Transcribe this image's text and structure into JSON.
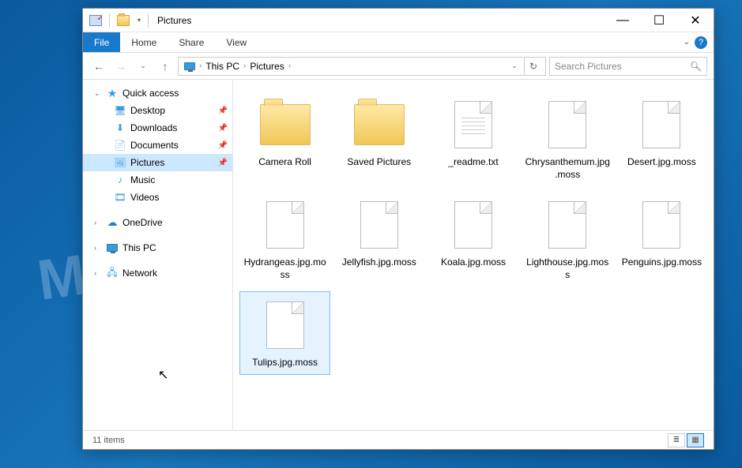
{
  "window": {
    "title": "Pictures",
    "controls": {
      "minimize": "—",
      "maximize": "☐",
      "close": "✕"
    }
  },
  "ribbon": {
    "file": "File",
    "tabs": [
      "Home",
      "Share",
      "View"
    ]
  },
  "nav": {
    "back": "←",
    "forward": "→",
    "up": "↑",
    "crumbs": [
      "This PC",
      "Pictures"
    ],
    "refresh": "↻",
    "search_placeholder": "Search Pictures"
  },
  "sidebar": {
    "quick_access": {
      "label": "Quick access",
      "expanded": true
    },
    "qa_items": [
      {
        "label": "Desktop",
        "icon": "desktop",
        "pinned": true
      },
      {
        "label": "Downloads",
        "icon": "downloads",
        "pinned": true
      },
      {
        "label": "Documents",
        "icon": "documents",
        "pinned": true
      },
      {
        "label": "Pictures",
        "icon": "pictures",
        "pinned": true,
        "selected": true
      },
      {
        "label": "Music",
        "icon": "music",
        "pinned": false
      },
      {
        "label": "Videos",
        "icon": "videos",
        "pinned": false
      }
    ],
    "onedrive": "OneDrive",
    "this_pc": "This PC",
    "network": "Network"
  },
  "items": [
    {
      "name": "Camera Roll",
      "kind": "folder"
    },
    {
      "name": "Saved Pictures",
      "kind": "folder"
    },
    {
      "name": "_readme.txt",
      "kind": "text"
    },
    {
      "name": "Chrysanthemum.jpg.moss",
      "kind": "file"
    },
    {
      "name": "Desert.jpg.moss",
      "kind": "file"
    },
    {
      "name": "Hydrangeas.jpg.moss",
      "kind": "file"
    },
    {
      "name": "Jellyfish.jpg.moss",
      "kind": "file"
    },
    {
      "name": "Koala.jpg.moss",
      "kind": "file"
    },
    {
      "name": "Lighthouse.jpg.moss",
      "kind": "file"
    },
    {
      "name": "Penguins.jpg.moss",
      "kind": "file"
    },
    {
      "name": "Tulips.jpg.moss",
      "kind": "file",
      "selected": true
    }
  ],
  "status": {
    "count_label": "11 items"
  },
  "watermark": "MYANTISPYWARE.COM"
}
